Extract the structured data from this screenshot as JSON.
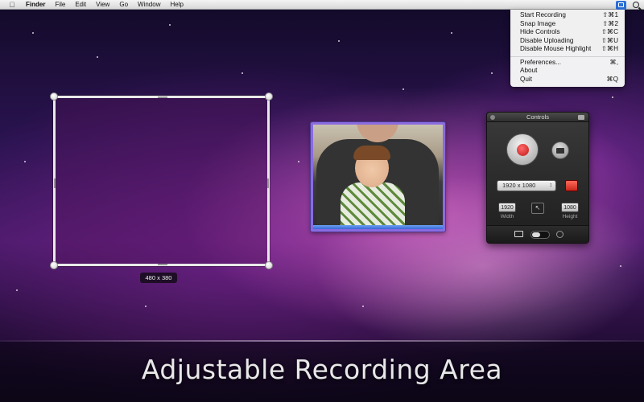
{
  "menubar": {
    "apple_icon": "apple-logo-icon",
    "items": [
      "Finder",
      "File",
      "Edit",
      "View",
      "Go",
      "Window",
      "Help"
    ],
    "status_icon": "screen-recorder-icon",
    "spotlight_icon": "spotlight-search-icon"
  },
  "dropdown": {
    "items": [
      {
        "label": "Start Recording",
        "shortcut": "⇧⌘1"
      },
      {
        "label": "Snap Image",
        "shortcut": "⇧⌘2"
      },
      {
        "label": "Hide Controls",
        "shortcut": "⇧⌘C"
      },
      {
        "label": "Disable Uploading",
        "shortcut": "⇧⌘U"
      },
      {
        "label": "Disable Mouse Highlight",
        "shortcut": "⇧⌘H"
      },
      {
        "label": "Preferences...",
        "shortcut": "⌘,"
      },
      {
        "label": "About",
        "shortcut": ""
      },
      {
        "label": "Quit",
        "shortcut": "⌘Q"
      }
    ]
  },
  "selection": {
    "size_label": "480 x 380"
  },
  "controls": {
    "title": "Controls",
    "resolution": "1920 x 1080",
    "width_value": "1920",
    "width_label": "Width",
    "height_value": "1080",
    "height_label": "Height"
  },
  "caption": "Adjustable Recording Area",
  "colors": {
    "accent": "#2a6fd8",
    "record_red": "#d92020",
    "webcam_border": "#8a6be0"
  }
}
